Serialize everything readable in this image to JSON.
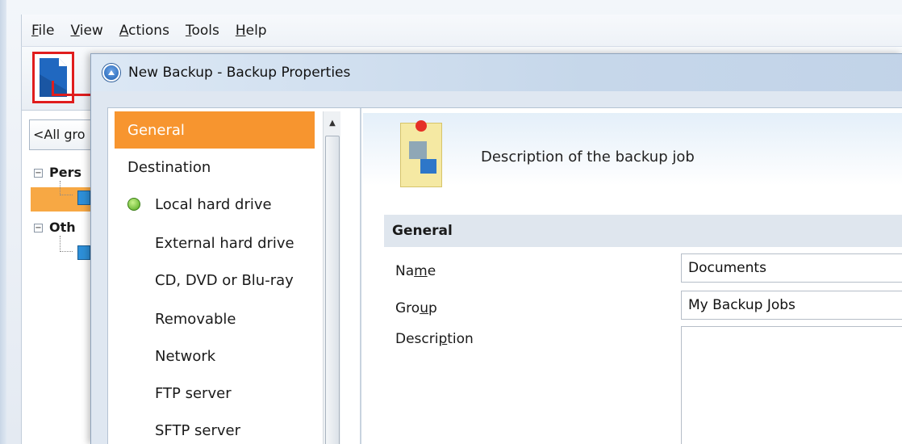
{
  "menu": [
    {
      "label": "File",
      "accel": "F",
      "rest": "ile"
    },
    {
      "label": "View",
      "accel": "V",
      "rest": "iew"
    },
    {
      "label": "Actions",
      "accel": "A",
      "rest": "ctions"
    },
    {
      "label": "Tools",
      "accel": "T",
      "rest": "ools"
    },
    {
      "label": "Help",
      "accel": "H",
      "rest": "elp"
    }
  ],
  "sidebar": {
    "group_combo": "<All gro",
    "tree": [
      {
        "label": "Pers",
        "bold": true
      },
      {
        "label": "Oth",
        "bold": true
      }
    ]
  },
  "dialog": {
    "title": "New Backup - Backup Properties",
    "nav": [
      {
        "label": "General",
        "active": true
      },
      {
        "label": "Destination"
      },
      {
        "label": "Local hard drive",
        "bullet": true
      },
      {
        "label": "External hard drive",
        "sub": true
      },
      {
        "label": "CD, DVD or Blu-ray",
        "sub": true
      },
      {
        "label": "Removable",
        "sub": true
      },
      {
        "label": "Network",
        "sub": true
      },
      {
        "label": "FTP server",
        "sub": true
      },
      {
        "label": "SFTP server",
        "sub": true
      }
    ],
    "pane": {
      "description": "Description of the backup job",
      "section": "General",
      "name_label_pre": "Na",
      "name_label_acc": "m",
      "name_label_post": "e",
      "name_value": "Documents",
      "group_label_pre": "Gro",
      "group_label_acc": "u",
      "group_label_post": "p",
      "group_value": "My Backup Jobs",
      "desc_label_pre": "Descri",
      "desc_label_acc": "p",
      "desc_label_post": "tion",
      "desc_value": ""
    }
  },
  "colors": {
    "accent": "#f7952f",
    "highlight_box": "#e01d1d",
    "status_green": "#4fa71c"
  },
  "icons": {
    "toolbar_new": "new-document-icon",
    "dialog": "backup-properties-icon",
    "pane": "note-pin-icon",
    "bullet": "status-green-dot-icon"
  }
}
